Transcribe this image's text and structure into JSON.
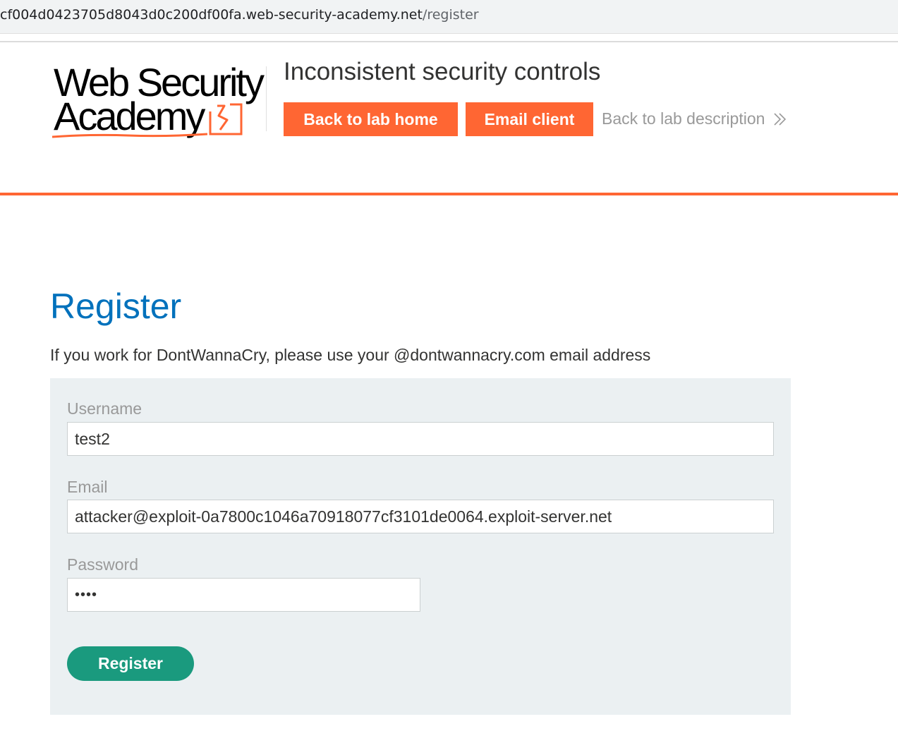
{
  "browser": {
    "url_host": "cf004d0423705d8043d0c200df00fa.web-security-academy.net",
    "url_path": "/register"
  },
  "header": {
    "logo_line1": "Web Security",
    "logo_line2": "Academy",
    "lab_title": "Inconsistent security controls",
    "back_home_label": "Back to lab home",
    "email_client_label": "Email client",
    "back_description_label": "Back to lab description"
  },
  "main": {
    "title": "Register",
    "intro": "If you work for DontWannaCry, please use your @dontwannacry.com email address",
    "form": {
      "username_label": "Username",
      "username_value": "test2",
      "email_label": "Email",
      "email_value": "attacker@exploit-0a7800c1046a70918077cf3101de0064.exploit-server.net",
      "password_label": "Password",
      "password_value": "••••",
      "submit_label": "Register"
    }
  },
  "colors": {
    "accent_orange": "#ff6633",
    "title_blue": "#0071bc",
    "register_green": "#1a9a7e",
    "panel_bg": "#ebf0f2"
  },
  "icons": {
    "logo": "web-security-academy-logo",
    "back_description": "double-chevron-right-icon"
  }
}
